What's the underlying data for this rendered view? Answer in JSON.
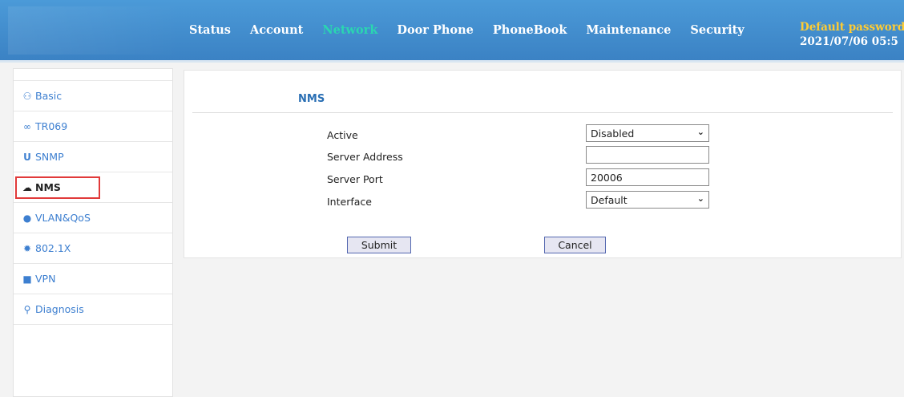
{
  "header": {
    "nav": [
      "Status",
      "Account",
      "Network",
      "Door Phone",
      "PhoneBook",
      "Maintenance",
      "Security"
    ],
    "active_nav": "Network",
    "warning": "Default password",
    "datetime": "2021/07/06 05:5"
  },
  "sidebar": {
    "items": [
      {
        "label": "Basic",
        "icon": "people-icon"
      },
      {
        "label": "TR069",
        "icon": "link-icon"
      },
      {
        "label": "SNMP",
        "icon": "magnet-icon"
      },
      {
        "label": "NMS",
        "icon": "cloud-icon"
      },
      {
        "label": "VLAN&QoS",
        "icon": "pin-icon"
      },
      {
        "label": "802.1X",
        "icon": "gear-icon"
      },
      {
        "label": "VPN",
        "icon": "lock-icon"
      },
      {
        "label": "Diagnosis",
        "icon": "search-icon"
      }
    ],
    "active": "NMS"
  },
  "main": {
    "title": "NMS",
    "fields": {
      "active": {
        "label": "Active",
        "value": "Disabled"
      },
      "server_address": {
        "label": "Server Address",
        "value": ""
      },
      "server_port": {
        "label": "Server Port",
        "value": "20006"
      },
      "interface": {
        "label": "Interface",
        "value": "Default"
      }
    },
    "submit_label": "Submit",
    "cancel_label": "Cancel"
  },
  "colors": {
    "header": "#3b82c4",
    "active_nav": "#2ad6b1",
    "warning": "#ffcc33",
    "link": "#3d7fd0",
    "highlight": "#e13a3a"
  }
}
